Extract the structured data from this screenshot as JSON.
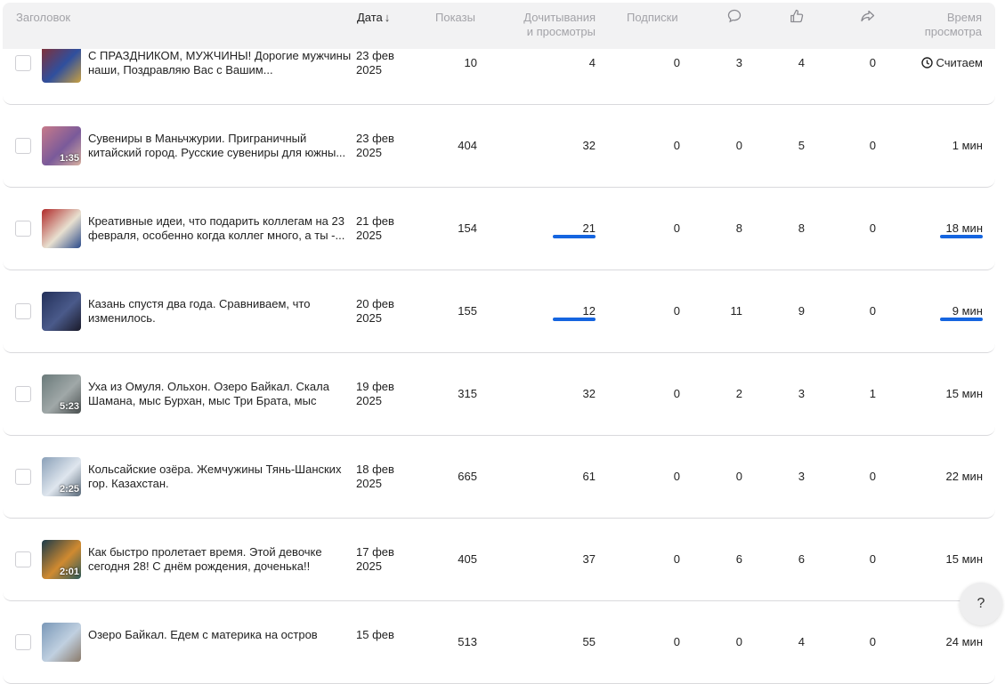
{
  "header": {
    "title": "Заголовок",
    "date": "Дата",
    "views": "Показы",
    "reads_1": "Дочитывания",
    "reads_2": "и просмотры",
    "subs": "Подписки",
    "watch_1": "Время",
    "watch_2": "просмотра",
    "icons": [
      "comment-icon",
      "like-icon",
      "share-icon"
    ],
    "sort_icon": "arrow-down-icon"
  },
  "accent_color": "#1565e0",
  "rows": [
    {
      "title": "С ПРАЗДНИКОМ, МУЖЧИНЫ! Дорогие мужчины наши, Поздравляю Вас с Вашим...",
      "date_1": "23 фев",
      "date_2": "2025",
      "views": "10",
      "reads": "4",
      "subs": "0",
      "comments": "3",
      "likes": "4",
      "shares": "0",
      "watch": "Считаем",
      "watch_pending": true,
      "duration": "",
      "thumb_colors": [
        "#8a2c2c",
        "#2f4f9e",
        "#c9a040"
      ]
    },
    {
      "title": "Сувениры в Маньчжурии. Приграничный китайский город. Русские сувениры для южны...",
      "date_1": "23 фев",
      "date_2": "2025",
      "views": "404",
      "reads": "32",
      "subs": "0",
      "comments": "0",
      "likes": "5",
      "shares": "0",
      "watch": "1 мин",
      "duration": "1:35",
      "thumb_colors": [
        "#c77a8a",
        "#7a5a9a",
        "#d8b0a0"
      ]
    },
    {
      "title": "Креативные идеи, что подарить коллегам на 23 февраля, особенно когда коллег много, а ты -...",
      "date_1": "21 фев",
      "date_2": "2025",
      "views": "154",
      "reads": "21",
      "subs": "0",
      "comments": "8",
      "likes": "8",
      "shares": "0",
      "watch": "18 мин",
      "reads_bar": true,
      "watch_bar": true,
      "duration": "",
      "thumb_colors": [
        "#b02a2a",
        "#e8e0d0",
        "#2a4a8a"
      ]
    },
    {
      "title": "Казань спустя два года. Сравниваем, что изменилось.",
      "date_1": "20 фев",
      "date_2": "2025",
      "views": "155",
      "reads": "12",
      "subs": "0",
      "comments": "11",
      "likes": "9",
      "shares": "0",
      "watch": "9 мин",
      "reads_bar": true,
      "watch_bar": true,
      "duration": "",
      "thumb_colors": [
        "#23305a",
        "#4a5a8a",
        "#1a1a2a"
      ]
    },
    {
      "title": "Уха из Омуля. Ольхон. Озеро Байкал. Скала Шамана, мыс Бурхан, мыс Три Брата, мыс Хобой.",
      "date_1": "19 фев",
      "date_2": "2025",
      "views": "315",
      "reads": "32",
      "subs": "0",
      "comments": "2",
      "likes": "3",
      "shares": "1",
      "watch": "15 мин",
      "duration": "5:23",
      "thumb_colors": [
        "#6a7a7a",
        "#a0a8a8",
        "#4a5050"
      ]
    },
    {
      "title": "Кольсайские озёра. Жемчужины Тянь-Шанских гор. Казахстан.",
      "date_1": "18 фев",
      "date_2": "2025",
      "views": "665",
      "reads": "61",
      "subs": "0",
      "comments": "0",
      "likes": "3",
      "shares": "0",
      "watch": "22 мин",
      "duration": "2:25",
      "thumb_colors": [
        "#8aa0b8",
        "#dfe6ee",
        "#5a6a7a"
      ]
    },
    {
      "title": "Как быстро пролетает время. Этой девочке сегодня 28! С днём рождения, доченька!!",
      "date_1": "17 фев",
      "date_2": "2025",
      "views": "405",
      "reads": "37",
      "subs": "0",
      "comments": "6",
      "likes": "6",
      "shares": "0",
      "watch": "15 мин",
      "duration": "2:01",
      "thumb_colors": [
        "#1a3a4a",
        "#d08a30",
        "#2a5a5a"
      ]
    },
    {
      "title": "Озеро Байкал. Едем с материка на остров",
      "date_1": "15 фев",
      "date_2": "",
      "views": "513",
      "reads": "55",
      "subs": "0",
      "comments": "0",
      "likes": "4",
      "shares": "0",
      "watch": "24 мин",
      "duration": "",
      "thumb_colors": [
        "#7a98b8",
        "#c0d0e0",
        "#8a7a6a"
      ]
    }
  ],
  "help_label": "?"
}
